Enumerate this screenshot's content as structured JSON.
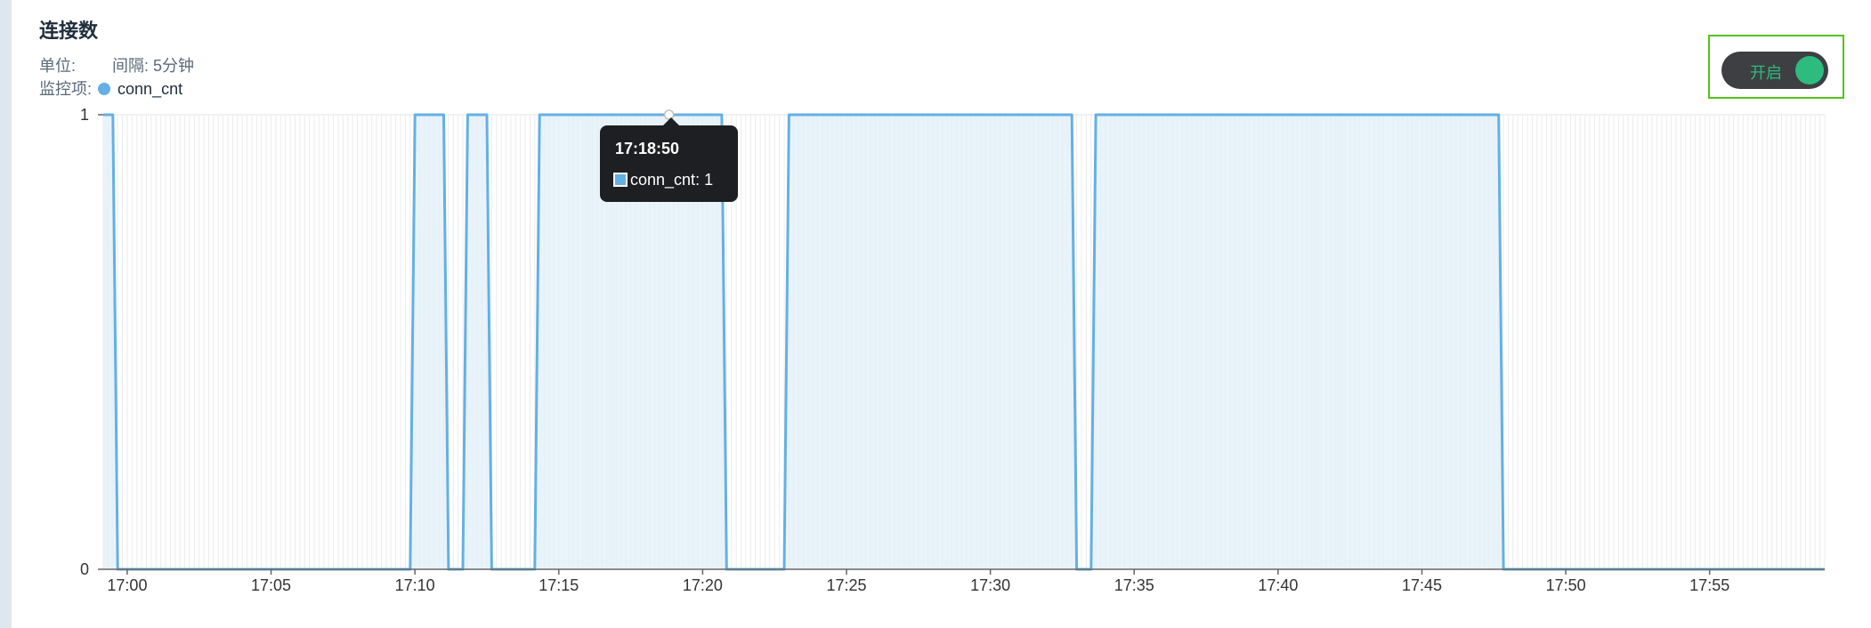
{
  "panel": {
    "title": "连接数",
    "unit_label": "单位:",
    "interval_label": "间隔: 5分钟",
    "items_label": "监控项:",
    "legend_name": "conn_cnt"
  },
  "toggle": {
    "label": "开启",
    "state": "on"
  },
  "tooltip": {
    "time": "17:18:50",
    "series": "conn_cnt",
    "value_text": ": 1"
  },
  "colors": {
    "line": "#64b0e4",
    "area": "#e1eff8",
    "toggle_on": "#2dbc7e",
    "highlight_border": "#52c41a"
  },
  "chart_data": {
    "type": "area",
    "title": "连接数",
    "xlabel": "",
    "ylabel": "",
    "series": [
      {
        "name": "conn_cnt"
      }
    ],
    "x_ticks": [
      "17:00",
      "17:05",
      "17:10",
      "17:15",
      "17:20",
      "17:25",
      "17:30",
      "17:35",
      "17:40",
      "17:45",
      "17:50",
      "17:55"
    ],
    "y_ticks": [
      "0",
      "1"
    ],
    "ylim": [
      0,
      1
    ],
    "xlim": [
      "16:59:10",
      "17:59:00"
    ],
    "grid": true,
    "points": [
      [
        "16:59:10",
        1
      ],
      [
        "16:59:30",
        1
      ],
      [
        "16:59:40",
        0
      ],
      [
        "17:09:50",
        0
      ],
      [
        "17:10:00",
        1
      ],
      [
        "17:11:00",
        1
      ],
      [
        "17:11:10",
        0
      ],
      [
        "17:11:40",
        0
      ],
      [
        "17:11:50",
        1
      ],
      [
        "17:12:30",
        1
      ],
      [
        "17:12:40",
        0
      ],
      [
        "17:14:10",
        0
      ],
      [
        "17:14:20",
        1
      ],
      [
        "17:20:40",
        1
      ],
      [
        "17:20:50",
        0
      ],
      [
        "17:22:50",
        0
      ],
      [
        "17:23:00",
        1
      ],
      [
        "17:32:50",
        1
      ],
      [
        "17:33:00",
        0
      ],
      [
        "17:33:30",
        0
      ],
      [
        "17:33:40",
        1
      ],
      [
        "17:47:40",
        1
      ],
      [
        "17:47:50",
        0
      ],
      [
        "17:59:00",
        0
      ]
    ]
  }
}
